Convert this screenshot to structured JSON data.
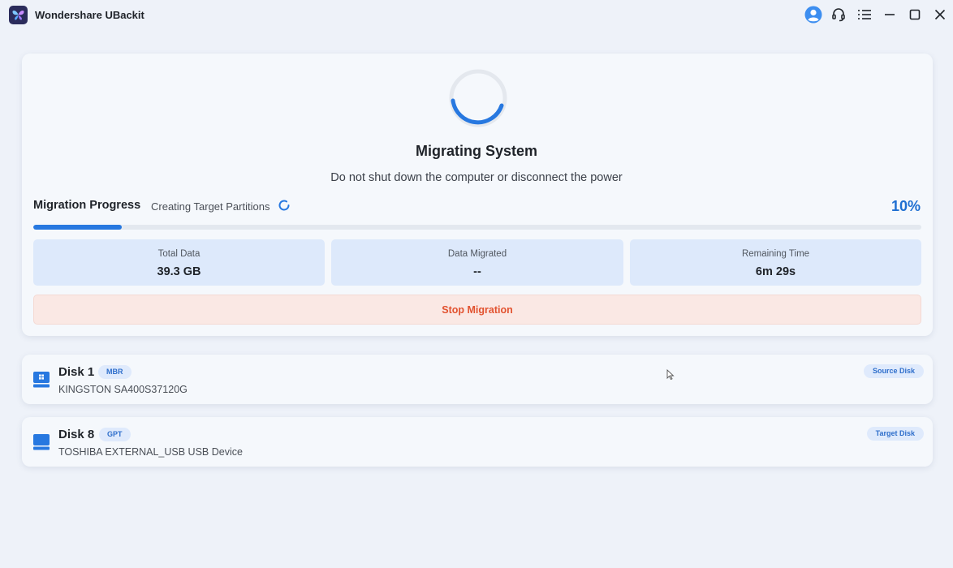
{
  "app": {
    "title": "Wondershare UBackit",
    "logo_icon": "butterfly-logo-icon"
  },
  "titlebar": {
    "icons": [
      "account-icon",
      "support-headset-icon",
      "menu-icon",
      "minimize-icon",
      "maximize-icon",
      "close-icon"
    ]
  },
  "migration": {
    "title": "Migrating System",
    "subtitle": "Do not shut down the computer or disconnect the power",
    "progress_label": "Migration Progress",
    "status": "Creating Target Partitions",
    "percent_text": "10%",
    "progress_fraction": 0.1,
    "stats": [
      {
        "label": "Total Data",
        "value": "39.3 GB"
      },
      {
        "label": "Data Migrated",
        "value": "--"
      },
      {
        "label": "Remaining Time",
        "value": "6m 29s"
      }
    ],
    "stop_label": "Stop Migration"
  },
  "disks": [
    {
      "name": "Disk 1",
      "partition_style": "MBR",
      "model": "KINGSTON SA400S37120G",
      "role": "Source Disk",
      "icon": "windows-disk-icon"
    },
    {
      "name": "Disk 8",
      "partition_style": "GPT",
      "model": "TOSHIBA EXTERNAL_USB USB Device",
      "role": "Target Disk",
      "icon": "external-disk-icon"
    }
  ],
  "colors": {
    "accent": "#2778e0",
    "stop": "#e2522f",
    "background": "#eef2f9"
  }
}
